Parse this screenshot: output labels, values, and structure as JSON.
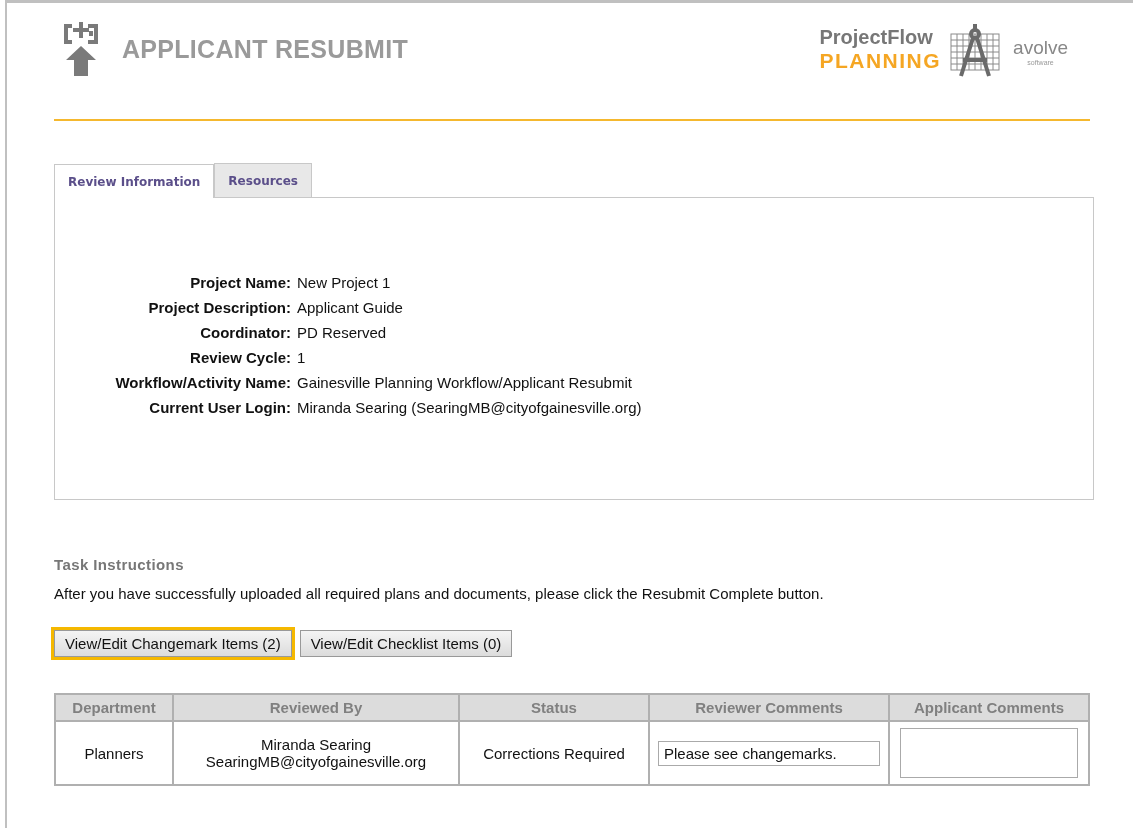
{
  "header": {
    "title": "APPLICANT RESUBMIT",
    "brand": {
      "line_1": "ProjectFlow",
      "line_2": "PLANNING"
    },
    "vendor": {
      "name": "avolve",
      "tagline": "software"
    }
  },
  "tabs": [
    {
      "label": "Review Information",
      "selected": true
    },
    {
      "label": "Resources",
      "selected": false
    }
  ],
  "review_info": [
    {
      "label": "Project Name:",
      "value": "New Project 1"
    },
    {
      "label": "Project Description:",
      "value": "Applicant Guide"
    },
    {
      "label": "Coordinator:",
      "value": "PD Reserved"
    },
    {
      "label": "Review Cycle:",
      "value": "1"
    },
    {
      "label": "Workflow/Activity Name:",
      "value": "Gainesville Planning Workflow/Applicant Resubmit"
    },
    {
      "label": "Current User Login:",
      "value": "Miranda Searing (SearingMB@cityofgainesville.org)"
    }
  ],
  "task_instructions": {
    "heading": "Task Instructions",
    "text": "After you have successfully uploaded all required plans and documents, please click the Resubmit Complete button."
  },
  "buttons": [
    {
      "label": "View/Edit Changemark Items (2)",
      "focused": true
    },
    {
      "label": "View/Edit Checklist Items (0)",
      "focused": false
    }
  ],
  "table": {
    "columns": [
      "Department",
      "Reviewed By",
      "Status",
      "Reviewer Comments",
      "Applicant Comments"
    ],
    "rows": [
      {
        "department": "Planners",
        "reviewer_name": "Miranda Searing",
        "reviewer_email": "SearingMB@cityofgainesville.org",
        "status": "Corrections Required",
        "reviewer_comments": "Please see changemarks."
      }
    ]
  }
}
